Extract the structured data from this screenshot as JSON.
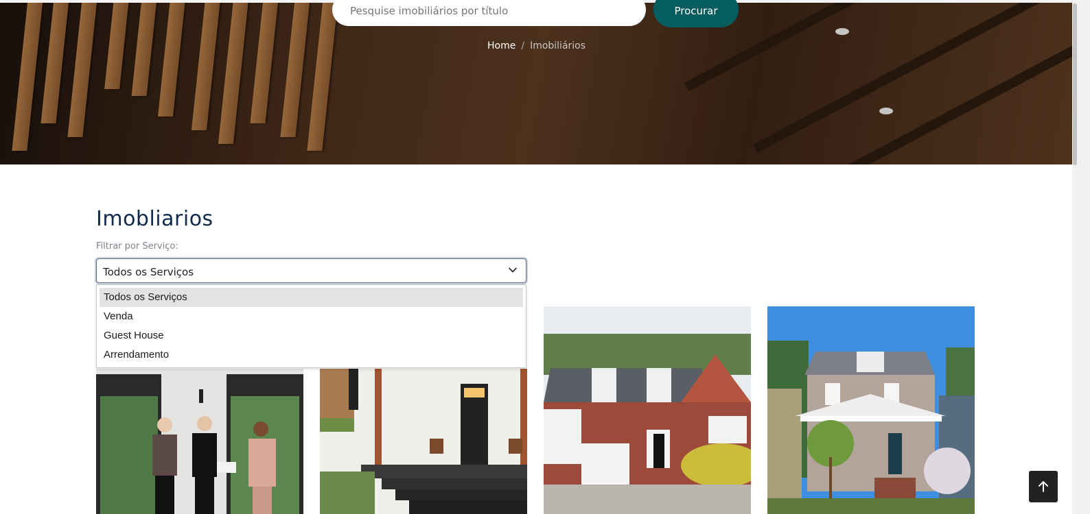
{
  "hero": {
    "search": {
      "placeholder": "Pesquise imobiliários por título",
      "button_label": "Procurar"
    },
    "breadcrumb": {
      "home": "Home",
      "separator": "/",
      "current": "Imobiliários"
    }
  },
  "main": {
    "title": "Imobliarios",
    "filter": {
      "label": "Filtrar por Serviço:",
      "selected": "Todos os Serviços",
      "options": [
        "Todos os Serviços",
        "Venda",
        "Guest House",
        "Arrendamento"
      ]
    }
  },
  "colors": {
    "accent": "#065d5d",
    "title": "#102a4c",
    "back_to_top_bg": "#222222"
  },
  "icons": {
    "select_chevron": "chevron-down-icon",
    "back_to_top": "arrow-up-icon"
  }
}
